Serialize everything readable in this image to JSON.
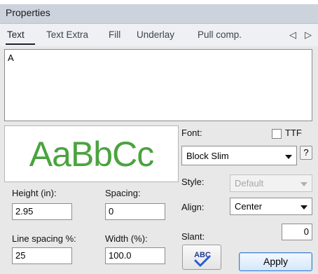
{
  "panel": {
    "title": "Properties"
  },
  "tabs": [
    {
      "label": "Text"
    },
    {
      "label": "Text Extra"
    },
    {
      "label": "Fill"
    },
    {
      "label": "Underlay"
    },
    {
      "label": "Pull comp."
    }
  ],
  "tab_scroll": {
    "left": "◁",
    "right": "▷"
  },
  "text_input": {
    "value": "A"
  },
  "preview": {
    "sample": "AaBbCc",
    "color": "#4aa33f"
  },
  "font": {
    "label": "Font:",
    "ttf_label": "TTF",
    "ttf_checked": false,
    "value": "Block Slim",
    "help_label": "?"
  },
  "style": {
    "label": "Style:",
    "value": "Default"
  },
  "align": {
    "label": "Align:",
    "value": "Center"
  },
  "slant": {
    "label": "Slant:",
    "value": "0"
  },
  "height": {
    "label": "Height (in):",
    "value": "2.95"
  },
  "spacing": {
    "label": "Spacing:",
    "value": "0"
  },
  "line_spacing": {
    "label": "Line spacing %:",
    "value": "25"
  },
  "width": {
    "label": "Width (%):",
    "value": "100.0"
  },
  "abc_button": {
    "text": "ABC"
  },
  "apply_button": {
    "label": "Apply"
  }
}
